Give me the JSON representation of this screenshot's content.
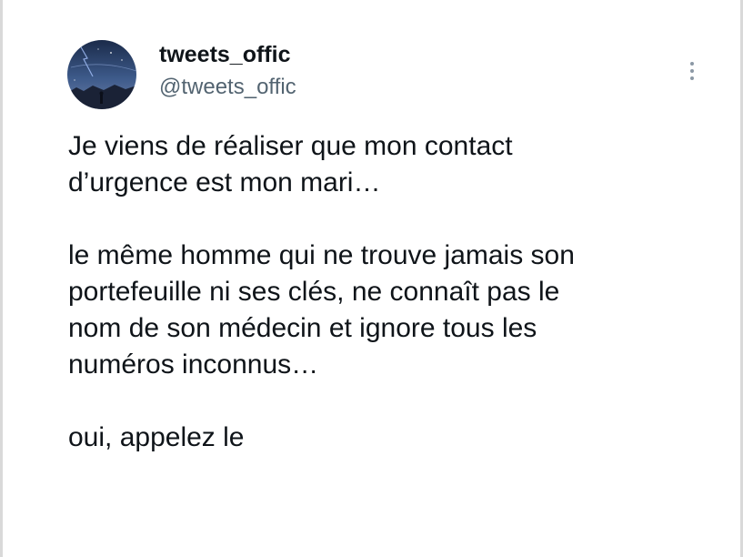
{
  "tweet": {
    "author": {
      "display_name": "tweets_offic",
      "handle": "@tweets_offic",
      "avatar_icon": "night-sky-avatar"
    },
    "more_icon": "vertical-ellipsis-icon",
    "paragraphs": [
      {
        "lines": [
          "Je viens de réaliser que mon contact",
          "d’urgence est mon mari…"
        ]
      },
      {
        "lines": [
          "le même homme qui ne trouve jamais son",
          "portefeuille ni ses clés, ne connaît pas le",
          "nom de son médecin et ignore tous les",
          "numéros inconnus…"
        ]
      },
      {
        "lines": [
          "oui, appelez le"
        ]
      }
    ]
  },
  "colors": {
    "text": "#0f1419",
    "secondary_text": "#536471",
    "icon": "#8b98a5",
    "background": "#ffffff"
  }
}
